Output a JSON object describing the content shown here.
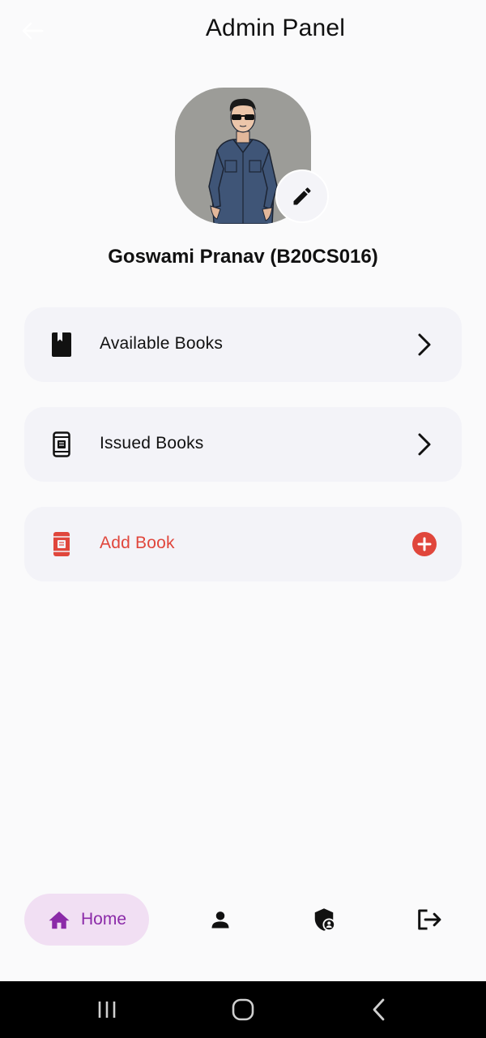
{
  "header": {
    "title": "Admin Panel",
    "back_icon": "arrow-left-icon"
  },
  "profile": {
    "name": "Goswami Pranav (B20CS016)",
    "edit_icon": "pencil-icon"
  },
  "menu": [
    {
      "label": "Available Books",
      "icon": "book-icon",
      "trailing": "chevron-right-icon"
    },
    {
      "label": "Issued Books",
      "icon": "book-device-icon",
      "trailing": "chevron-right-icon"
    },
    {
      "label": "Add Book",
      "icon": "book-device-icon",
      "trailing": "add-circle-icon",
      "color": "#e0463c"
    }
  ],
  "bottom_nav": {
    "home_label": "Home",
    "items": [
      "home-icon",
      "person-icon",
      "admin-shield-icon",
      "logout-icon"
    ],
    "active_bg": "#f1dff3",
    "active_color": "#8b2aa8"
  },
  "system_nav": [
    "recent-apps-icon",
    "home-circle-icon",
    "back-chevron-icon"
  ]
}
